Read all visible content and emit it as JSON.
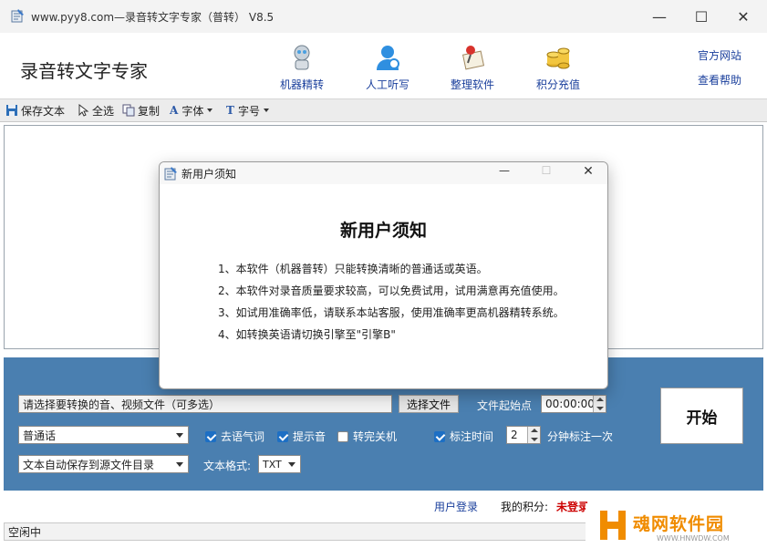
{
  "window": {
    "title": "www.pyy8.com—录音转文字专家（普转） V8.5",
    "controls": {
      "minimize": "—",
      "maximize": "☐",
      "close": "✕"
    }
  },
  "header": {
    "brand": "录音转文字专家",
    "nav": [
      {
        "label": "机器精转",
        "icon": "robot-icon"
      },
      {
        "label": "人工听写",
        "icon": "person-headset-icon"
      },
      {
        "label": "整理软件",
        "icon": "pin-note-icon"
      },
      {
        "label": "积分充值",
        "icon": "coins-icon"
      }
    ],
    "links": {
      "official_site": "官方网站",
      "help": "查看帮助"
    }
  },
  "toolbar": {
    "save": "保存文本",
    "select_all": "全选",
    "copy": "复制",
    "font": "字体",
    "font_size": "字号"
  },
  "panel": {
    "file_input_placeholder": "请选择要转换的音、视频文件（可多选）",
    "choose_file": "选择文件",
    "start_point_label": "文件起始点",
    "start_point_value": "00:00:00",
    "start_button": "开始",
    "language": "普通话",
    "checkboxes": [
      {
        "label": "去语气词",
        "checked": true
      },
      {
        "label": "提示音",
        "checked": true
      },
      {
        "label": "转完关机",
        "checked": false
      },
      {
        "label": "标注时间",
        "checked": true
      }
    ],
    "interval_value": "2",
    "interval_suffix": "分钟标注一次",
    "save_location": "文本自动保存到源文件目录",
    "format_label": "文本格式:",
    "format_value": "TXT"
  },
  "footer": {
    "login": "用户登录",
    "points_label": "我的积分:",
    "points_value": "未登录",
    "status": "空闲中"
  },
  "dialog": {
    "title": "新用户须知",
    "heading": "新用户须知",
    "lines": [
      "1、本软件（机器普转）只能转换清晰的普通话或英语。",
      "2、本软件对录音质量要求较高，可以免费试用，试用满意再充值使用。",
      "3、如试用准确率低，请联系本站客服，使用准确率更高机器精转系统。",
      "4、如转换英语请切换引擎至\"引擎B\""
    ]
  },
  "watermark": {
    "text": "魂网软件园",
    "sub": "WWW.HNWDW.COM"
  },
  "colors": {
    "panel_blue": "#4a7fb0",
    "link_blue": "#1a3f9c",
    "points_red": "#cc0000",
    "check_blue": "#1d6fc4",
    "watermark_orange": "#f08c00"
  }
}
